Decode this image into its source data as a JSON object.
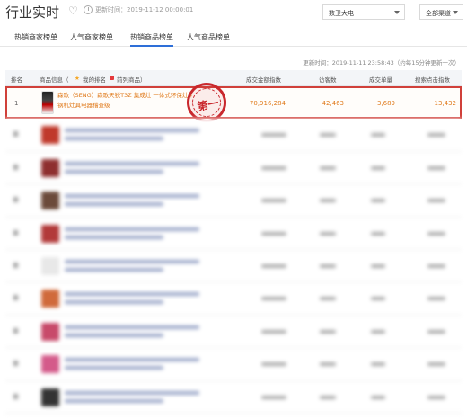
{
  "header": {
    "title": "行业实时",
    "update_label": "更新时间：2019-11-12 00:00:01",
    "category_select": "数卫大电",
    "channel_select": "全部渠道"
  },
  "tabs": [
    {
      "label": "热销商家榜单",
      "active": false
    },
    {
      "label": "人气商家榜单",
      "active": false
    },
    {
      "label": "热销商品榜单",
      "active": true
    },
    {
      "label": "人气商品榜单",
      "active": false
    }
  ],
  "refresh_text": "更新时间：2019-11-11 23:58:43（约每15分钟更新一次）",
  "table": {
    "columns": {
      "rank": "排名",
      "info": "商品信息（",
      "mine": "我的排名",
      "top": "前列商品）",
      "amount": "成交金额指数",
      "visit": "访客数",
      "sold": "成交单量",
      "conversion": "搜索点击指数"
    },
    "top_row": {
      "rank": "1",
      "title": "森歌（SENG）森歌天锐T3Z 集成灶 一体式环保灶 带消毒柜 蒸烤灶 地排式防油烟机 燃气灶套装 套装",
      "title_line2": "钢机灶具电器稽查级",
      "amount": "70,916,284",
      "visitors": "42,463",
      "orders": "3,689",
      "conversion": "13,432",
      "badge": "第一"
    },
    "blurred_ranks": [
      "2",
      "3",
      "4",
      "5",
      "6",
      "7",
      "8",
      "9",
      "10"
    ]
  }
}
